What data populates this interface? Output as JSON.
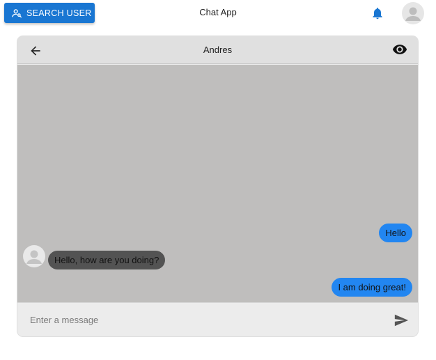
{
  "topbar": {
    "search_label": "SEARCH USER",
    "search_icon": "person-search-icon",
    "app_title": "Chat App",
    "notification_icon": "bell-icon",
    "avatar_icon": "avatar-icon"
  },
  "chat": {
    "contact_name": "Andres",
    "back_icon": "arrow-left-icon",
    "view_icon": "eye-icon",
    "messages": [
      {
        "direction": "sent",
        "text": "Hello"
      },
      {
        "direction": "received",
        "text": "Hello, how are you doing?"
      },
      {
        "direction": "sent",
        "text": "I am doing great!"
      }
    ],
    "input_placeholder": "Enter a message",
    "input_value": "",
    "send_icon": "send-icon"
  },
  "colors": {
    "primary": "#1976d2",
    "sent_bubble": "#2286f1",
    "received_bubble": "#535353",
    "messages_background": "#bfbebd",
    "header_background": "#e0e0e0"
  }
}
